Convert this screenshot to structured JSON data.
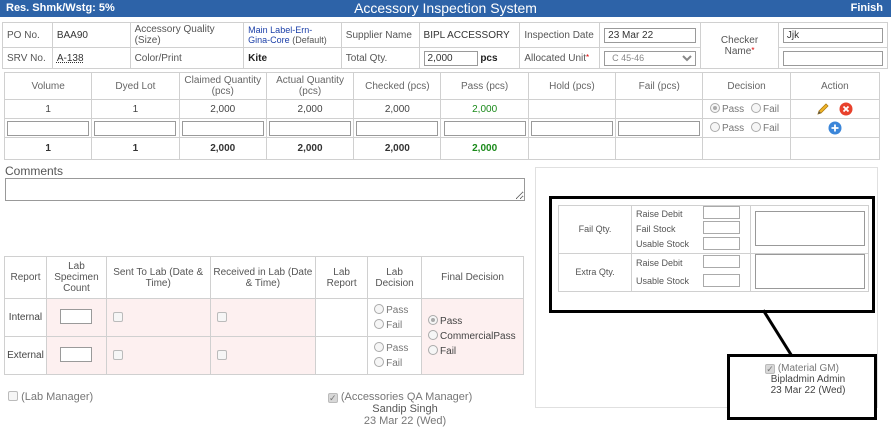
{
  "topbar": {
    "shrinkage": "Res. Shmk/Wstg: 5%",
    "title": "Accessory Inspection System",
    "finish": "Finish"
  },
  "header": {
    "po_label": "PO No.",
    "po_value": "BAA90",
    "srv_label": "SRV No.",
    "srv_value": "A-138",
    "quality_label": "Accessory Quality (Size)",
    "quality_value_1": "Main Label-Ern-",
    "quality_value_2": "Gina-Core",
    "quality_value_3": "(Default)",
    "color_label": "Color/Print",
    "color_value": "Kite",
    "supplier_label": "Supplier Name",
    "supplier_value": "BIPL ACCESSORY",
    "total_label": "Total Qty.",
    "total_value": "2,000",
    "total_unit": "pcs",
    "date_label": "Inspection Date",
    "date_value": "23 Mar 22",
    "alloc_label": "Allocated Unit",
    "alloc_value": "C 45-46",
    "checker_label": "Checker Name",
    "checker_value": "Jjk"
  },
  "grid": {
    "headers": [
      "Volume",
      "Dyed Lot",
      "Claimed Quantity (pcs)",
      "Actual Quantity (pcs)",
      "Checked (pcs)",
      "Pass (pcs)",
      "Hold (pcs)",
      "Fail (pcs)",
      "Decision",
      "Action"
    ],
    "row1": {
      "volume": "1",
      "dyed_lot": "1",
      "claimed": "2,000",
      "actual": "2,000",
      "checked": "2,000",
      "pass": "2,000",
      "hold": "",
      "fail": ""
    },
    "decision_pass": "Pass",
    "decision_fail": "Fail",
    "totals": {
      "volume": "1",
      "dyed_lot": "1",
      "claimed": "2,000",
      "actual": "2,000",
      "checked": "2,000",
      "pass": "2,000"
    }
  },
  "comments_label": "Comments",
  "lab": {
    "headers": [
      "Report",
      "Lab Specimen Count",
      "Sent To Lab (Date & Time)",
      "Received in Lab (Date & Time)",
      "Lab Report",
      "Lab Decision",
      "Final Decision"
    ],
    "rows": [
      "Internal",
      "External"
    ],
    "pass": "Pass",
    "fail": "Fail",
    "final_pass": "Pass",
    "final_commercial": "CommercialPass",
    "final_fail": "Fail"
  },
  "approvals": {
    "lab_manager": "(Lab Manager)",
    "qa_manager": "(Accessories QA Manager)",
    "qa_name": "Sandip Singh",
    "qa_date": "23 Mar 22 (Wed)",
    "gm": "(Material GM)",
    "gm_name": "Bipladmin Admin",
    "gm_date": "23 Mar 22 (Wed)"
  },
  "qty_panel": {
    "fail_qty": "Fail Qty.",
    "raise_debit": "Raise Debit",
    "fail_stock": "Fail Stock",
    "usable_stock": "Usable Stock",
    "extra_qty": "Extra Qty.",
    "raise_debit_2": "Raise Debit",
    "usable_stock_2": "Usable Stock"
  },
  "colors": {
    "topbar": "#2d63a8",
    "pass_green": "#1a8a1a",
    "delete_red": "#e8412c",
    "add_blue": "#3b86d9"
  }
}
